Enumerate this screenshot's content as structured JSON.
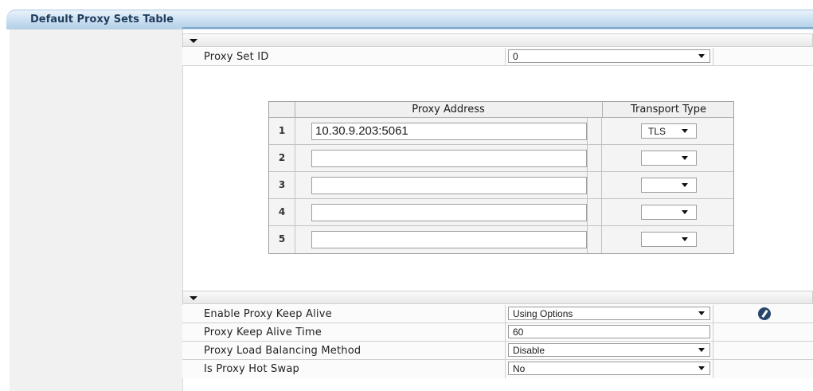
{
  "window": {
    "title": "Default Proxy Sets Table"
  },
  "proxy_set": {
    "label": "Proxy Set ID",
    "value": "0"
  },
  "proxy_table": {
    "headers": {
      "address": "Proxy Address",
      "transport": "Transport Type"
    },
    "rows": [
      {
        "index": "1",
        "address": "10.30.9.203:5061",
        "transport": "TLS"
      },
      {
        "index": "2",
        "address": "",
        "transport": ""
      },
      {
        "index": "3",
        "address": "",
        "transport": ""
      },
      {
        "index": "4",
        "address": "",
        "transport": ""
      },
      {
        "index": "5",
        "address": "",
        "transport": ""
      }
    ]
  },
  "settings": {
    "keep_alive": {
      "label": "Enable Proxy Keep Alive",
      "value": "Using Options"
    },
    "keep_alive_time": {
      "label": "Proxy Keep Alive Time",
      "value": "60"
    },
    "load_balancing": {
      "label": "Proxy Load Balancing Method",
      "value": "Disable"
    },
    "hot_swap": {
      "label": "Is Proxy Hot Swap",
      "value": "No"
    }
  },
  "colors": {
    "title_bar": "#c9def0",
    "title_text": "#1f3d5c",
    "edit_icon": "#26466d"
  }
}
